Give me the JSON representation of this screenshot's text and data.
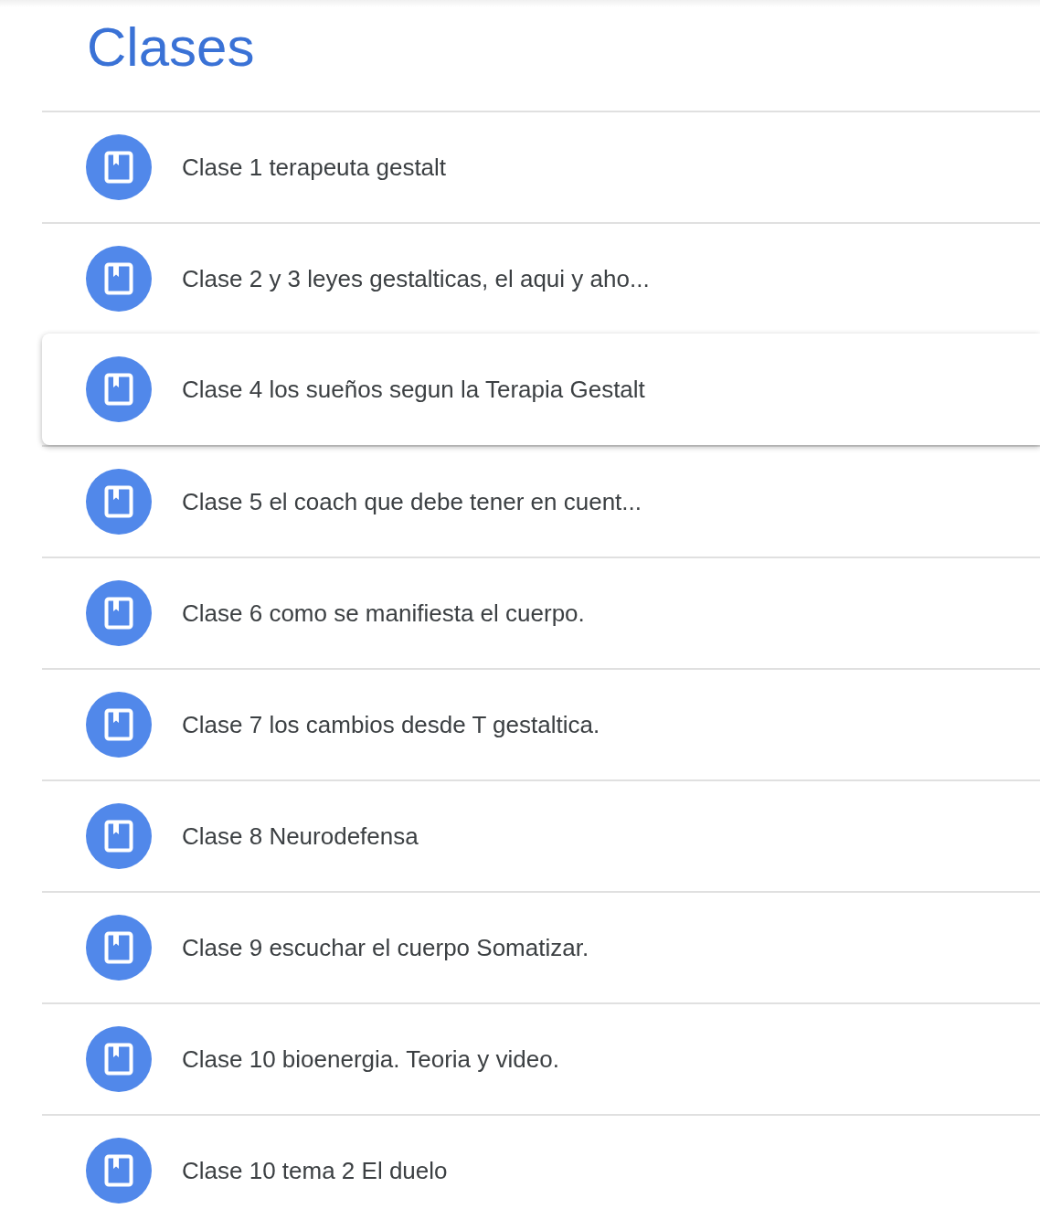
{
  "title": "Clases",
  "items": [
    {
      "label": "Clase 1 terapeuta gestalt",
      "selected": false
    },
    {
      "label": "Clase 2 y 3 leyes gestalticas, el aqui y aho...",
      "selected": false
    },
    {
      "label": "Clase 4 los sueños segun la Terapia Gestalt",
      "selected": true
    },
    {
      "label": "Clase 5 el coach que debe tener en cuent...",
      "selected": false
    },
    {
      "label": "Clase 6 como se manifiesta el cuerpo.",
      "selected": false
    },
    {
      "label": "Clase 7 los cambios desde T gestaltica.",
      "selected": false
    },
    {
      "label": "Clase 8 Neurodefensa",
      "selected": false
    },
    {
      "label": "Clase 9 escuchar el cuerpo Somatizar.",
      "selected": false
    },
    {
      "label": "Clase 10 bioenergia. Teoria y video.",
      "selected": false
    },
    {
      "label": "Clase 10 tema 2 El duelo",
      "selected": false
    }
  ]
}
